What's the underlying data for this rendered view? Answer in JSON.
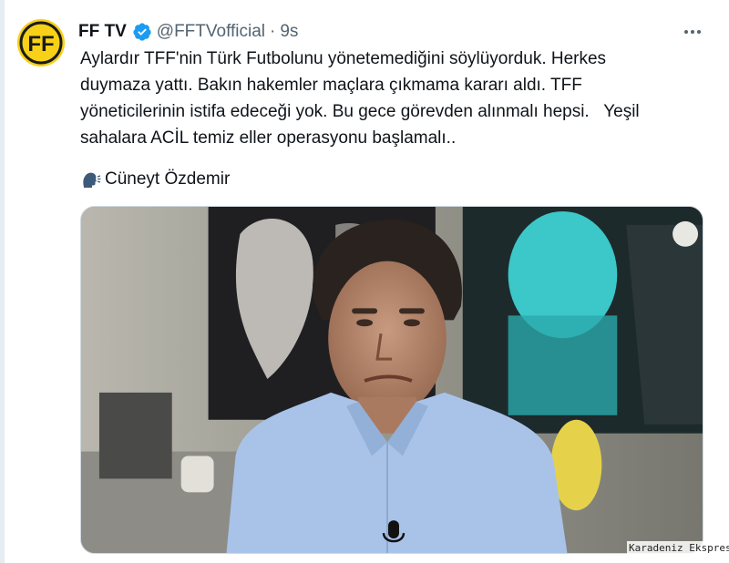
{
  "tweet": {
    "author_name": "FF TV",
    "verified_icon": "verified-badge-icon",
    "handle": "@FFTVofficial",
    "separator": "·",
    "time": "9s",
    "more_icon": "more-options-icon",
    "text_lines": [
      "Aylardır TFF'nin Türk Futbolunu yönetemediğini söylüyorduk. Herkes",
      "duymaza yattı. Bakın hakemler maçlara çıkmama kararı aldı. TFF",
      "yöneticilerinin istifa edeceği yok. Bu gece görevden alınmalı hepsi.   Yeşil",
      "sahalara ACİL temiz eller operasyonu başlamalı.."
    ],
    "speaker_icon": "speaking-head-icon",
    "speaker_name": "Cüneyt Özdemir",
    "avatar": {
      "logo_letters": "FF",
      "bg_color": "#f7d117",
      "fg_color": "#1a1a1a"
    },
    "media": {
      "type": "video-thumbnail",
      "shirt_color": "#a9c3e8",
      "microphone_icon": "microphone-icon"
    }
  },
  "colors": {
    "verified_blue": "#1d9bf0",
    "secondary_text": "#536471",
    "primary_text": "#0f1419"
  },
  "watermark": "Karadeniz Ekspres"
}
